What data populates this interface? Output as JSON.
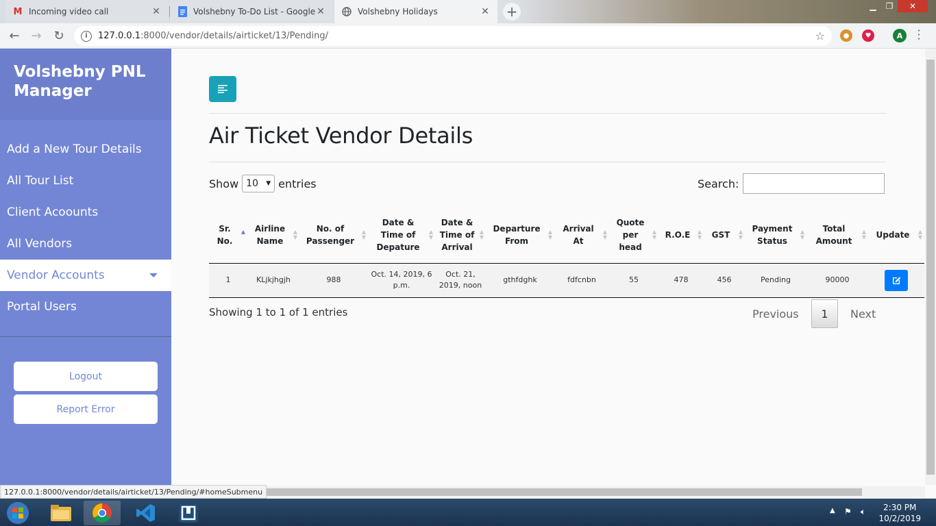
{
  "browser": {
    "tabs": [
      {
        "title": "Incoming video call",
        "icon": "gmail-icon",
        "active": false
      },
      {
        "title": "Volshebny To-Do List - Google D",
        "icon": "docs-icon",
        "active": false
      },
      {
        "title": "Volshebny Holidays",
        "icon": "globe-icon",
        "active": true
      }
    ],
    "url_host": "127.0.0.1",
    "url_path": ":8000/vendor/details/airticket/13/Pending/",
    "profile_initial": "A",
    "status_url": "127.0.0.1:8000/vendor/details/airticket/13/Pending/#homeSubmenu"
  },
  "sidebar": {
    "brand": "Volshebny PNL Manager",
    "items": [
      {
        "label": "Add a New Tour Details"
      },
      {
        "label": "All Tour List"
      },
      {
        "label": "Client Acoounts"
      },
      {
        "label": "All Vendors"
      },
      {
        "label": "Vendor Accounts",
        "active": true
      },
      {
        "label": "Portal Users"
      }
    ],
    "logout": "Logout",
    "report": "Report Error"
  },
  "main": {
    "title": "Air Ticket Vendor Details",
    "show_label": "Show",
    "entries_value": "10",
    "entries_label": "entries",
    "search_label": "Search:",
    "columns": [
      "Sr. No.",
      "Airline Name",
      "No. of Passenger",
      "Date & Time of Depature",
      "Date & Time of Arrival",
      "Departure From",
      "Arrival At",
      "Quote per head",
      "R.O.E",
      "GST",
      "Payment Status",
      "Total Amount",
      "Update"
    ],
    "rows": [
      [
        "1",
        "KLjkjhgjh",
        "988",
        "Oct. 14, 2019, 6 p.m.",
        "Oct. 21, 2019, noon",
        "gthfdghk",
        "fdfcnbn",
        "55",
        "478",
        "456",
        "Pending",
        "90000"
      ]
    ],
    "info": "Showing 1 to 1 of 1 entries",
    "pager": {
      "previous": "Previous",
      "page": "1",
      "next": "Next"
    }
  },
  "taskbar": {
    "time": "2:30 PM",
    "date": "10/2/2019"
  },
  "colors": {
    "sidebar": "#7386d5",
    "brand": "#6d7fcc",
    "toggle": "#17a2b8",
    "edit": "#007bff"
  }
}
